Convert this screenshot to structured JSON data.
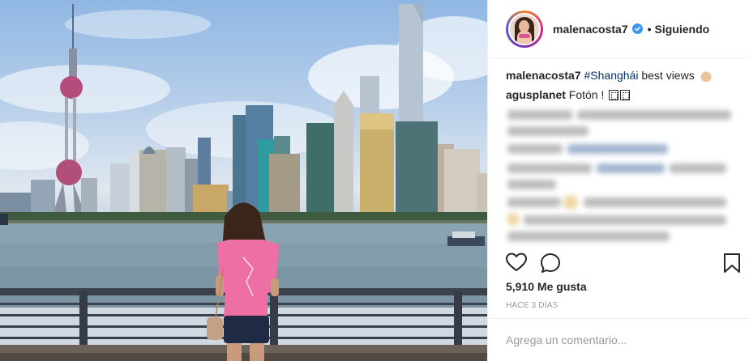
{
  "post": {
    "username": "malenacosta7",
    "dot": "•",
    "follow_status": "Siguiendo"
  },
  "caption": {
    "username": "malenacosta7",
    "hashtag": "#Shanghái",
    "text": " best views"
  },
  "comment": {
    "username": "agusplanet",
    "text": "Fotón !"
  },
  "likes": "5,910 Me gusta",
  "time_ago": "HACE 3 DÍAS",
  "add_comment": {
    "placeholder": "Agrega un comentario..."
  },
  "icons": {
    "verified": "verified-badge-icon",
    "like": "heart-icon",
    "comment": "comment-bubble-icon",
    "save": "bookmark-icon",
    "emoji": "ok-hand-emoji-icon"
  },
  "colors": {
    "verified_blue": "#3897f0",
    "hashtag": "#003569",
    "muted": "#999999",
    "border": "#efefef"
  }
}
